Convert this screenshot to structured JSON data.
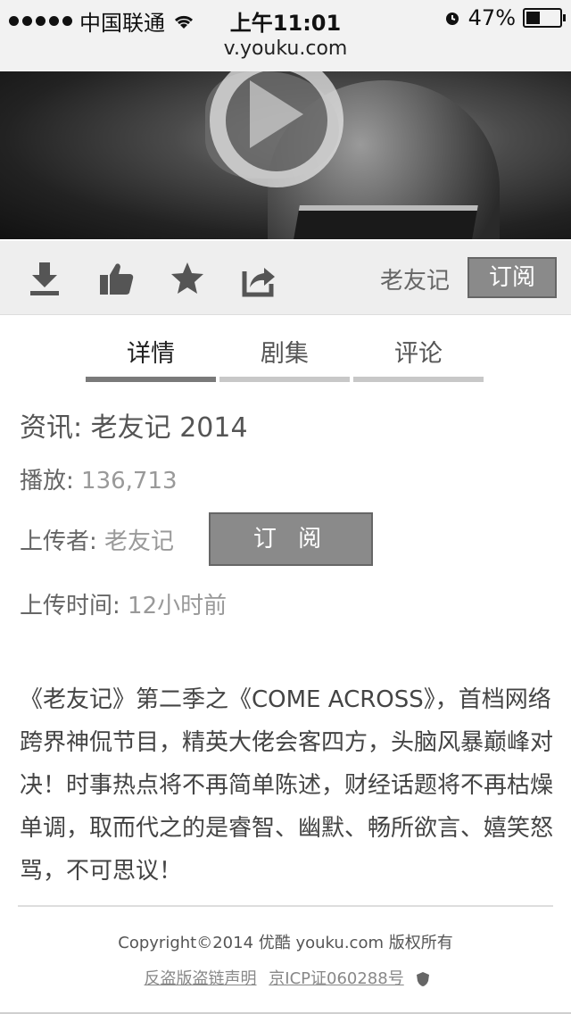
{
  "status_bar": {
    "carrier": "中国联通",
    "time": "上午11:01",
    "battery_percent": "47%",
    "battery_level": 0.47
  },
  "url_bar": {
    "url": "v.youku.com"
  },
  "toolbar": {
    "icons": [
      "download-icon",
      "thumbs-up-icon",
      "star-icon",
      "share-icon"
    ],
    "channel_name": "老友记",
    "subscribe_label": "订阅"
  },
  "tabs": [
    {
      "label": "详情",
      "active": true
    },
    {
      "label": "剧集",
      "active": false
    },
    {
      "label": "评论",
      "active": false
    }
  ],
  "details": {
    "title_prefix": "资讯:",
    "title_value": "老友记 2014",
    "plays_label": "播放:",
    "plays_value": "136,713",
    "uploader_label": "上传者:",
    "uploader_value": "老友记",
    "subscribe_label": "订 阅",
    "time_label": "上传时间:",
    "time_value": "12小时前"
  },
  "description": "《老友记》第二季之《COME ACROSS》，首档网络跨界神侃节目，精英大佬会客四方，头脑风暴巅峰对决！时事热点将不再简单陈述，财经话题将不再枯燥单调，取而代之的是睿智、幽默、畅所欲言、嬉笑怒骂，不可思议！",
  "footer": {
    "copyright": "Copyright©2014 优酷 youku.com 版权所有",
    "link_antipiracy": "反盗版盗链声明",
    "link_icp": "京ICP证060288号"
  },
  "colors": {
    "bar_bg": "#f2f2f2",
    "toolbar_bg": "#eeeeee",
    "button_gray": "#8a8a8a",
    "tab_active": "#7a7a7a",
    "tab_inactive": "#c8c8c8"
  }
}
